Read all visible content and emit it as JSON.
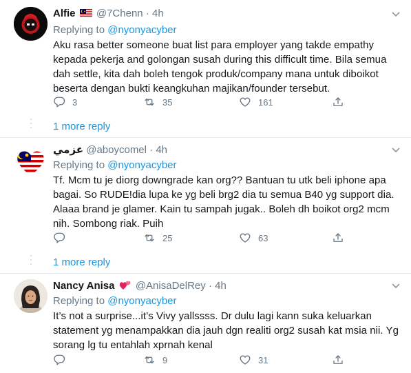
{
  "tweets": [
    {
      "name": "Alfie",
      "handle": "@7Chenn",
      "dot": "·",
      "time": "4h",
      "replying_prefix": "Replying to ",
      "replying_to": "@nyonyacyber",
      "text": "Aku rasa better someone buat list para employer yang takde empathy kepada pekerja and golongan susah during this difficult time. Bila semua dah settle, kita dah boleh tengok produk/company mana untuk diboikot beserta dengan bukti keangkuhan majikan/founder tersebut.",
      "replies": "3",
      "retweets": "35",
      "likes": "161",
      "more_reply": "1 more reply"
    },
    {
      "name": "عزمي",
      "handle": "@aboycomel",
      "dot": "·",
      "time": "4h",
      "replying_prefix": "Replying to ",
      "replying_to": "@nyonyacyber",
      "text": "Tf. Mcm tu je diorg downgrade kan org?? Bantuan tu utk beli iphone apa bagai. So RUDE!dia lupa ke yg beli brg2 dia tu semua B40 yg support dia. Alaaa brand je glamer. Kain tu sampah jugak.. Boleh dh boikot org2 mcm nih. Sombong riak. Puih",
      "replies": "",
      "retweets": "25",
      "likes": "63",
      "more_reply": "1 more reply"
    },
    {
      "name": "Nancy Anisa",
      "handle": "@AnisaDelRey",
      "dot": "·",
      "time": "4h",
      "replying_prefix": "Replying to ",
      "replying_to": "@nyonyacyber",
      "text": "It’s not a surprise...it’s Vivy yallssss. Dr dulu lagi kann suka keluarkan statement yg menampakkan dia jauh dgn realiti org2 susah kat msia nii. Yg sorang lg tu entahlah xprnah kenal",
      "replies": "",
      "retweets": "9",
      "likes": "31"
    }
  ],
  "icons": {
    "caret": "chevron-down-icon",
    "reply": "reply-icon",
    "retweet": "retweet-icon",
    "like": "heart-icon",
    "share": "share-icon"
  },
  "colors": {
    "link": "#1b95e0",
    "muted": "#657786",
    "text": "#14171a"
  }
}
